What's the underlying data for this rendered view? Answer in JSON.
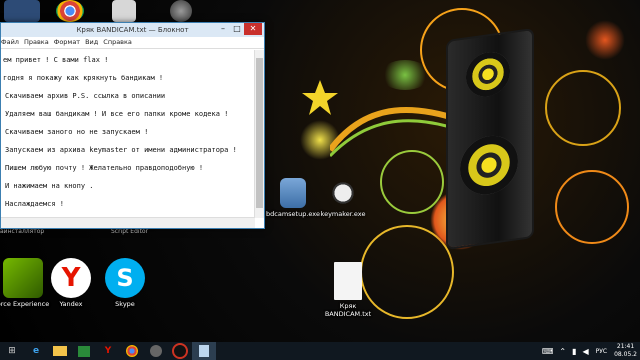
{
  "notepad": {
    "title": "Кряк BANDICAM.txt — Блокнот",
    "menu": [
      "Файл",
      "Правка",
      "Формат",
      "Вид",
      "Справка"
    ],
    "lines": [
      "ем привет ! С вами flax !",
      "годня я покажу как крякнуть бандикам !",
      "Скачиваем архив P.S. ссылка в описании",
      "Удаляем ваш бандикам ! И все его папки кроме кодека !",
      "Скачиваем заного но не запускаем !",
      "Запускаем из архива keymaster от имени администратора !",
      "Пишем любую почту ! Желательно правдоподобную !",
      "И нажимаем на кнопу .",
      "Наслаждаемся !"
    ]
  },
  "desktop_icons": {
    "behind_notepad_label": "Script Editor",
    "left_label_fragment": "аинсталлятор",
    "bdcamsetup": "bdcamsetup.exe",
    "keymaker": "keymaker.exe",
    "nvidia": "orce Experience",
    "yandex": "Yandex",
    "skype": "Skype",
    "txt_file": "Кряк BANDICAM.txt"
  },
  "taskbar": {
    "lang": "РУС",
    "time": "21:41",
    "date": "08.05.2"
  },
  "colors": {
    "notepad_border": "#3c7fb1",
    "taskbar": "#101820",
    "wallpaper_accent": "#f6a21a"
  }
}
